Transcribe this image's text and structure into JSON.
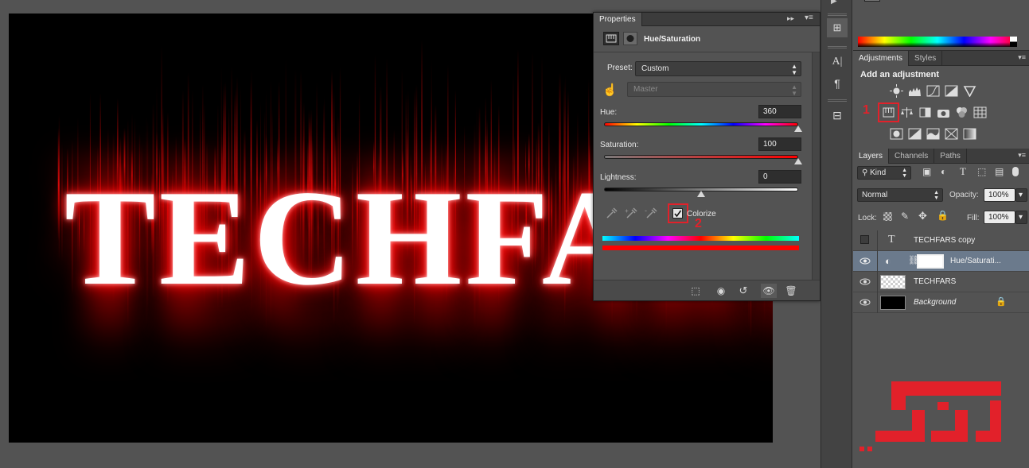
{
  "canvas": {
    "text": "TECHFARS"
  },
  "properties_panel": {
    "tab": "Properties",
    "title": "Hue/Saturation",
    "preset_label": "Preset:",
    "preset_value": "Custom",
    "channel_value": "Master",
    "hue_label": "Hue:",
    "hue_value": "360",
    "saturation_label": "Saturation:",
    "saturation_value": "100",
    "lightness_label": "Lightness:",
    "lightness_value": "0",
    "colorize_label": "Colorize",
    "colorize_checked": true,
    "hue_fraction": 1.0,
    "saturation_fraction": 1.0,
    "lightness_fraction": 0.5
  },
  "annotations": {
    "step1": "1",
    "step2": "2",
    "highlight_color": "#e2212a"
  },
  "adjustments_panel": {
    "tabs": [
      "Adjustments",
      "Styles"
    ],
    "title": "Add an adjustment"
  },
  "layers_panel": {
    "tabs": [
      "Layers",
      "Channels",
      "Paths"
    ],
    "filter_kind": "Kind",
    "blend_mode": "Normal",
    "opacity_label": "Opacity:",
    "opacity_value": "100%",
    "lock_label": "Lock:",
    "fill_label": "Fill:",
    "fill_value": "100%",
    "layers": [
      {
        "name": "TECHFARS copy",
        "visible": false,
        "kind": "text"
      },
      {
        "name": "Hue/Saturati...",
        "visible": true,
        "kind": "adjustment",
        "selected": true
      },
      {
        "name": "TECHFARS",
        "visible": true,
        "kind": "pixel"
      },
      {
        "name": "Background",
        "visible": true,
        "kind": "background",
        "locked": true
      }
    ]
  },
  "colors": {
    "accent_red": "#e2212a",
    "panel_bg": "#535353",
    "selection": "#6b7a8c"
  },
  "icons": [
    "expand-icon",
    "panel-menu-icon",
    "hue-saturation-icon",
    "mask-icon",
    "finger-scrub-icon",
    "eyedropper-icon",
    "eyedropper-plus-icon",
    "eyedropper-minus-icon",
    "clip-to-layer-icon",
    "view-previous-icon",
    "reset-icon",
    "visibility-icon",
    "trash-icon",
    "eye-icon",
    "link-icon",
    "lock-icon",
    "text-layer-icon",
    "logo"
  ]
}
